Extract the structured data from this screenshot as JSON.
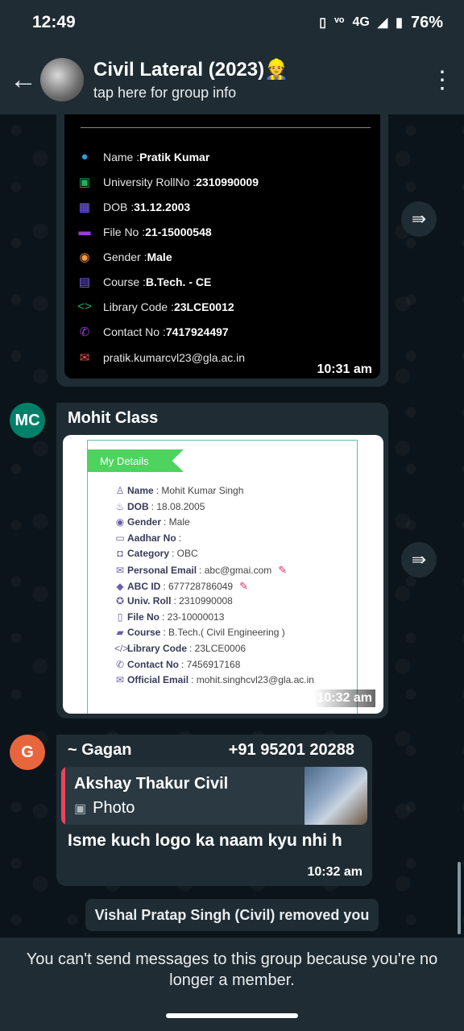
{
  "status_bar": {
    "time": "12:49",
    "network": "4G",
    "battery": "76%"
  },
  "header": {
    "title": "Civil Lateral (2023)👷",
    "subtitle": "tap here for group info"
  },
  "msg1": {
    "details": [
      {
        "icon": "person-icon",
        "label": "Name : ",
        "value": "Pratik Kumar"
      },
      {
        "icon": "id-card-icon",
        "label": "University RollNo : ",
        "value": "2310990009"
      },
      {
        "icon": "calendar-icon",
        "label": "DOB : ",
        "value": "31.12.2003"
      },
      {
        "icon": "folder-icon",
        "label": "File No : ",
        "value": "21-15000548"
      },
      {
        "icon": "gender-icon",
        "label": "Gender : ",
        "value": "Male"
      },
      {
        "icon": "book-icon",
        "label": "Course : ",
        "value": "B.Tech. - CE"
      },
      {
        "icon": "code-icon",
        "label": "Library Code : ",
        "value": "23LCE0012"
      },
      {
        "icon": "phone-icon",
        "label": "Contact No : ",
        "value": "7417924497"
      },
      {
        "icon": "mail-icon",
        "label": "",
        "value": "pratik.kumarcvl23@gla.ac.in"
      }
    ],
    "time": "10:31 am"
  },
  "msg2": {
    "avatar_initials": "MC",
    "sender": "Mohit Class",
    "ribbon": "My Details",
    "details": [
      {
        "icon": "user-icon",
        "label": "Name",
        "value": ": Mohit Kumar Singh"
      },
      {
        "icon": "cake-icon",
        "label": "DOB",
        "value": ": 18.08.2005"
      },
      {
        "icon": "gender-icon",
        "label": "Gender",
        "value": ": Male"
      },
      {
        "icon": "aadhar-icon",
        "label": "Aadhar No",
        "value": ":"
      },
      {
        "icon": "camera-icon",
        "label": "Category",
        "value": ": OBC"
      },
      {
        "icon": "email-icon",
        "label": "Personal Email",
        "value": ": abc@gmai.com"
      },
      {
        "icon": "tag-icon",
        "label": "ABC ID",
        "value": ": 677728786049"
      },
      {
        "icon": "badge-icon",
        "label": "Univ. Roll",
        "value": ": 2310990008"
      },
      {
        "icon": "file-icon",
        "label": "File No",
        "value": ": 23-10000013"
      },
      {
        "icon": "course-icon",
        "label": "Course",
        "value": ": B.Tech.( Civil Engineering )"
      },
      {
        "icon": "code-icon",
        "label": "Library Code",
        "value": ": 23LCE0006"
      },
      {
        "icon": "phone-icon",
        "label": "Contact No",
        "value": ": 7456917168"
      },
      {
        "icon": "envelope-icon",
        "label": "Official Email",
        "value": ": mohit.singhcvl23@gla.ac.in"
      }
    ],
    "time": "10:32 am"
  },
  "msg3": {
    "avatar_initial": "G",
    "sender": "~ Gagan",
    "phone": "+91 95201 20288",
    "quote_name": "Akshay Thakur Civil",
    "quote_type": "Photo",
    "text": "Isme kuch logo ka naam kyu nhi h",
    "time": "10:32 am"
  },
  "system_message": "Vishal Pratap Singh (Civil) removed you",
  "footer_notice": "You can't send messages to this group because you're no longer a member."
}
